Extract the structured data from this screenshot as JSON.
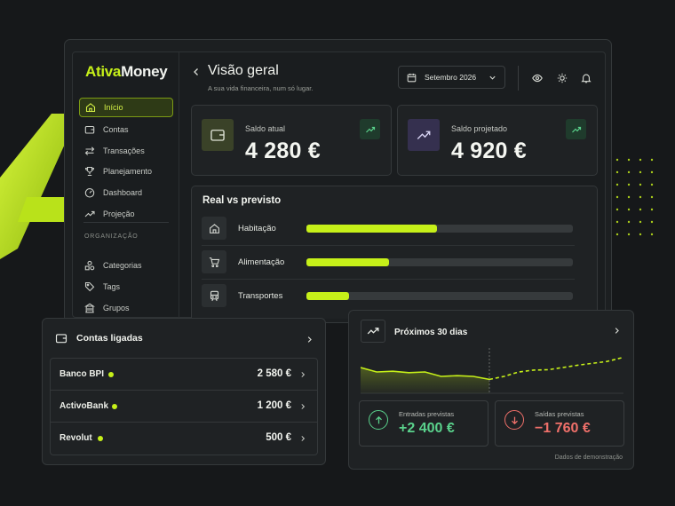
{
  "colors": {
    "accent": "#c6f019",
    "positive": "#5ad28c",
    "negative": "#f0706a",
    "background": "#16181a"
  },
  "brand": {
    "name_part1": "Ativa",
    "name_part2": "Money"
  },
  "sidebar": {
    "items": [
      {
        "label": "Início",
        "icon": "home-icon",
        "active": true
      },
      {
        "label": "Contas",
        "icon": "wallet-icon"
      },
      {
        "label": "Transações",
        "icon": "transfer-arrows-icon"
      },
      {
        "label": "Planejamento",
        "icon": "trophy-icon"
      },
      {
        "label": "Dashboard",
        "icon": "gauge-icon"
      },
      {
        "label": "Projeção",
        "icon": "trend-up-icon"
      }
    ],
    "section_caption": "ORGANIZAÇÃO",
    "org_items": [
      {
        "label": "Categorias",
        "icon": "shapes-icon"
      },
      {
        "label": "Tags",
        "icon": "tag-icon"
      },
      {
        "label": "Grupos",
        "icon": "building-icon"
      }
    ]
  },
  "header": {
    "title": "Visão geral",
    "subtitle": "A sua vida financeira, num só lugar.",
    "date_selector": "Setembro 2026",
    "icons": [
      "eye-icon",
      "sun-icon",
      "bell-icon"
    ]
  },
  "stats": [
    {
      "label": "Saldo atual",
      "value": "4 280 €",
      "icon": "wallet-icon",
      "trend_icon": "trend-up-icon"
    },
    {
      "label": "Saldo projetado",
      "value": "4 920 €",
      "icon": "chart-up-icon",
      "trend_icon": "trend-up-icon"
    }
  ],
  "real_vs_previsto": {
    "title": "Real vs previsto",
    "rows": [
      {
        "label": "Habitação",
        "icon": "house-icon",
        "fraction": 0.49
      },
      {
        "label": "Alimentação",
        "icon": "cart-icon",
        "fraction": 0.31
      },
      {
        "label": "Transportes",
        "icon": "train-icon",
        "fraction": 0.16
      }
    ]
  },
  "accounts": {
    "title": "Contas ligadas",
    "rows": [
      {
        "name": "Banco BPI",
        "value": "2 580 €"
      },
      {
        "name": "ActivoBank",
        "value": "1 200 €"
      },
      {
        "name": "Revolut",
        "value": "500 €"
      }
    ]
  },
  "forecast": {
    "title": "Próximos 30 dias",
    "chart_data": {
      "type": "line",
      "series": [
        {
          "values": [
            0.62,
            0.5,
            0.52,
            0.48,
            0.5,
            0.38,
            0.4,
            0.38,
            0.3
          ]
        },
        {
          "values": [
            0.3,
            0.38,
            0.5,
            0.55,
            0.56,
            0.62,
            0.68,
            0.73,
            0.78,
            0.88
          ]
        }
      ]
    },
    "inflow": {
      "label": "Entradas previstas",
      "value": "+2 400 €"
    },
    "outflow": {
      "label": "Saídas previstas",
      "value": "−1 760 €"
    },
    "footnote": "Dados de demonstração"
  }
}
